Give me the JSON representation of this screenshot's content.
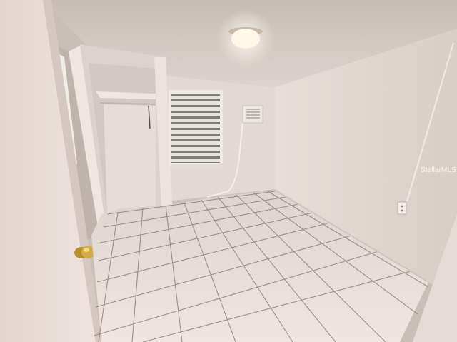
{
  "photo": {
    "watermark_text": "StellarMLS",
    "colors": {
      "ceiling": "#d4cbc6",
      "back_wall": "#e4dad5",
      "right_wall": "#e2d8d2",
      "left_wall": "#ddd1cc",
      "floor_tile": "#e7dcd8",
      "grout": "#8a7e7a",
      "door": "#e9ddd9",
      "door_knob": "#c9a23a",
      "light": "#fff6e6"
    }
  }
}
